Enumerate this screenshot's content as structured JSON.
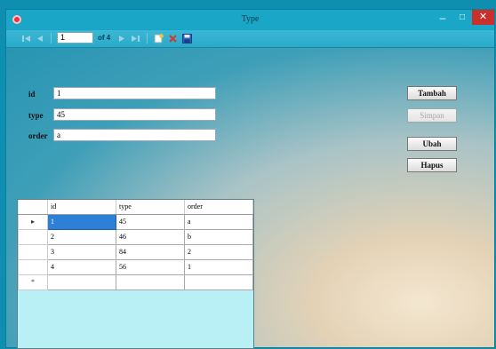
{
  "window": {
    "title": "Type",
    "close_glyph": "✕",
    "min_glyph": "–",
    "max_glyph": "□"
  },
  "toolbar": {
    "position_value": "1",
    "of_text": "of 4"
  },
  "form": {
    "fields": [
      {
        "label": "id",
        "value": "1"
      },
      {
        "label": "type",
        "value": "45"
      },
      {
        "label": "order",
        "value": "a"
      }
    ],
    "buttons": [
      {
        "label": "Tambah",
        "enabled": true
      },
      {
        "label": "Simpan",
        "enabled": false
      },
      {
        "label": "Ubah",
        "enabled": true
      },
      {
        "label": "Hapus",
        "enabled": true
      }
    ]
  },
  "grid": {
    "columns": [
      "id",
      "type",
      "order"
    ],
    "rows": [
      {
        "marker": "▸",
        "cells": [
          "1",
          "45",
          "a"
        ]
      },
      {
        "marker": "",
        "cells": [
          "2",
          "46",
          "b"
        ]
      },
      {
        "marker": "",
        "cells": [
          "3",
          "84",
          "2"
        ]
      },
      {
        "marker": "",
        "cells": [
          "4",
          "56",
          "1"
        ]
      }
    ],
    "new_row_marker": "*",
    "selected_cell": "rows.0.id"
  },
  "colors": {
    "window_accent": "#18a3c4",
    "close_button": "#c8302b",
    "grid_background": "#b8f0f5",
    "selected_cell": "#2e7fd6"
  }
}
